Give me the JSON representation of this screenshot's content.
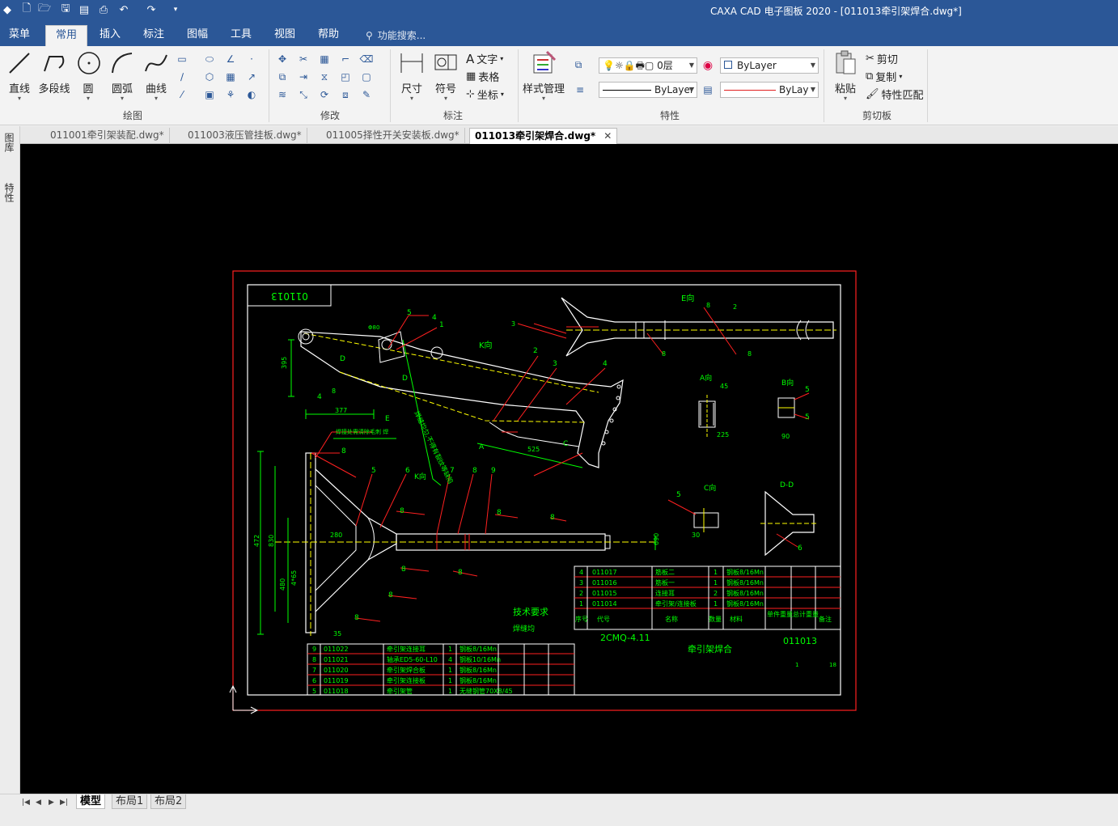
{
  "window": {
    "title": "CAXA CAD 电子图板 2020 - [011013牵引架焊合.dwg*]"
  },
  "ribbon_tabs": [
    {
      "label": "菜单",
      "active": false
    },
    {
      "label": "常用",
      "active": true
    },
    {
      "label": "插入",
      "active": false
    },
    {
      "label": "标注",
      "active": false
    },
    {
      "label": "图幅",
      "active": false
    },
    {
      "label": "工具",
      "active": false
    },
    {
      "label": "视图",
      "active": false
    },
    {
      "label": "帮助",
      "active": false
    }
  ],
  "search": {
    "placeholder": "功能搜索..."
  },
  "groups": {
    "draw": {
      "label": "绘图",
      "buttons": [
        {
          "label": "直线",
          "icon": "line-icon"
        },
        {
          "label": "多段线",
          "icon": "polyline-icon"
        },
        {
          "label": "圆",
          "icon": "circle-icon"
        },
        {
          "label": "圆弧",
          "icon": "arc-icon"
        },
        {
          "label": "曲线",
          "icon": "curve-icon"
        }
      ]
    },
    "modify": {
      "label": "修改"
    },
    "annotate": {
      "label": "标注",
      "buttons": [
        {
          "label": "尺寸",
          "icon": "dimension-icon"
        },
        {
          "label": "符号",
          "icon": "symbol-icon"
        }
      ],
      "small": [
        {
          "label": "文字",
          "icon": "text-icon"
        },
        {
          "label": "表格",
          "icon": "table-icon"
        },
        {
          "label": "坐标",
          "icon": "coordinate-icon"
        }
      ]
    },
    "properties": {
      "label": "特性",
      "style_manager": "样式管理",
      "layer": "0层",
      "color": "ByLayer",
      "linetype": "ByLayer",
      "lineweight": "ByLay"
    },
    "clipboard": {
      "label": "剪切板",
      "paste": "粘贴",
      "cut": "剪切",
      "copy": "复制",
      "match": "特性匹配"
    }
  },
  "doc_tabs": [
    {
      "label": "011001牵引架装配.dwg*",
      "active": false
    },
    {
      "label": "011003液压管挂板.dwg*",
      "active": false
    },
    {
      "label": "011005择性开关安装板.dwg*",
      "active": false
    },
    {
      "label": "011013牵引架焊合.dwg*",
      "active": true
    }
  ],
  "side_panels": [
    "图库",
    "特性"
  ],
  "drawing": {
    "drawing_no_box": "011013",
    "view_labels": {
      "E": "E向",
      "A": "A向",
      "B": "B向",
      "C": "C向",
      "DD": "D-D",
      "K": "K向"
    },
    "tech_requirements": {
      "title": "技术要求",
      "text": "焊缝均"
    },
    "parts_table_right": [
      {
        "no": "4",
        "code": "011017",
        "name": "筋板二",
        "qty": "1",
        "material": "钢板8/16Mn"
      },
      {
        "no": "3",
        "code": "011016",
        "name": "筋板一",
        "qty": "1",
        "material": "钢板8/16Mn"
      },
      {
        "no": "2",
        "code": "011015",
        "name": "连接耳",
        "qty": "2",
        "material": "钢板8/16Mn"
      },
      {
        "no": "1",
        "code": "011014",
        "name": "牵引架/连接板",
        "qty": "1",
        "material": "钢板8/16Mn"
      }
    ],
    "parts_header": [
      "序号",
      "代号",
      "名称",
      "数量",
      "材料",
      "单件重量",
      "总计重量",
      "备注"
    ],
    "parts_table_left": [
      {
        "no": "9",
        "code": "011022",
        "name": "牵引架连接耳",
        "qty": "1",
        "material": "钢板8/16Mn"
      },
      {
        "no": "8",
        "code": "011021",
        "name": "轴承ED5-60-L10",
        "qty": "4",
        "material": "钢板10/16Mn"
      },
      {
        "no": "7",
        "code": "011020",
        "name": "牵引架焊合板",
        "qty": "1",
        "material": "钢板8/16Mn"
      },
      {
        "no": "6",
        "code": "011019",
        "name": "牵引架连接板",
        "qty": "1",
        "material": "钢板8/16Mn"
      },
      {
        "no": "5",
        "code": "011018",
        "name": "牵引架管",
        "qty": "1",
        "material": "无缝钢管70X8/45"
      }
    ],
    "title_block": {
      "project": "2CMQ-4.11",
      "name": "牵引架焊合",
      "drawing_no": "011013",
      "sheet": "1",
      "scale": "18"
    },
    "dims": [
      "395",
      "377",
      "45",
      "225",
      "90",
      "30",
      "472",
      "830",
      "480",
      "4*65",
      "35",
      "525",
      "280",
      "690"
    ]
  },
  "layout_tabs": [
    {
      "label": "模型",
      "active": true
    },
    {
      "label": "布局1",
      "active": false
    },
    {
      "label": "布局2",
      "active": false
    }
  ],
  "colors": {
    "title_bar": "#2b5797",
    "canvas": "#000000",
    "frame": "#ff0000",
    "geometry": "#ffffff",
    "annotation": "#00ff00",
    "leader": "#ff0000"
  }
}
